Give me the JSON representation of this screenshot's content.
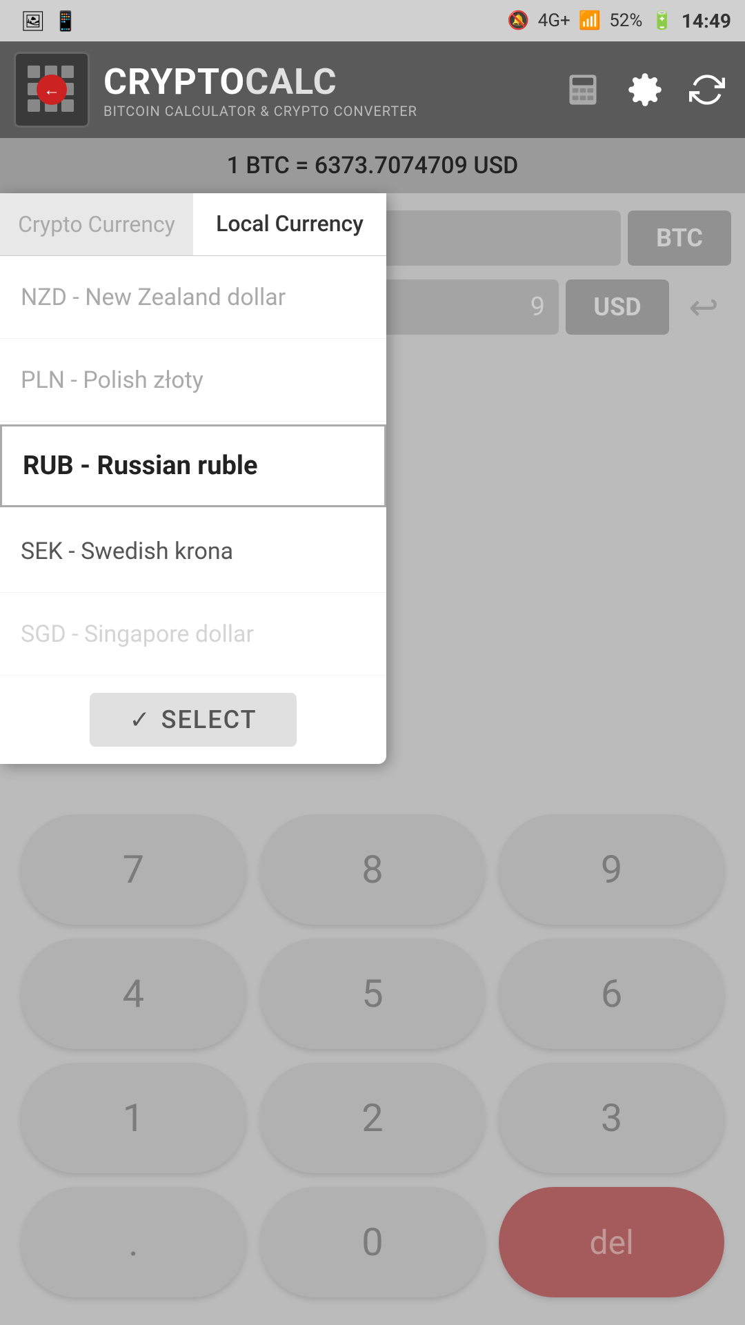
{
  "statusBar": {
    "leftIcons": [
      "image-icon",
      "phone-icon"
    ],
    "rightIcons": "🔕 4G+ .il 52% 🔋 14:49",
    "signal": "4G+",
    "battery": "52%",
    "time": "14:49"
  },
  "header": {
    "appName": "CRYPTOCALC",
    "cryptoPart": "CRYPTO",
    "calcPart": "CALC",
    "subtitle": "BITCOIN CALCULATOR & CRYPTO CONVERTER",
    "icons": {
      "calculator": "calculator-icon",
      "settings": "settings-icon",
      "refresh": "refresh-icon"
    }
  },
  "rateBar": {
    "text": "1 BTC = 6373.7074709 USD"
  },
  "currencyRows": [
    {
      "value": "",
      "currency": "BTC"
    },
    {
      "value": "9",
      "currency": "USD"
    }
  ],
  "modal": {
    "tabs": [
      {
        "label": "Crypto Currency",
        "active": false
      },
      {
        "label": "Local Currency",
        "active": true
      }
    ],
    "listItems": [
      {
        "code": "NZD",
        "name": "New Zealand dollar",
        "selected": false,
        "fade": true
      },
      {
        "code": "PLN",
        "name": "Polish złoty",
        "selected": false,
        "fade": true
      },
      {
        "code": "RUB",
        "name": "Russian ruble",
        "selected": true,
        "fade": false
      },
      {
        "code": "SEK",
        "name": "Swedish krona",
        "selected": false,
        "fade": false
      },
      {
        "code": "SGD",
        "name": "Singapore dollar",
        "selected": false,
        "fade": true,
        "partial": true
      }
    ],
    "selectButton": {
      "label": "SELECT",
      "icon": "✓"
    }
  },
  "keypad": {
    "keys": [
      {
        "label": "7",
        "type": "number"
      },
      {
        "label": "8",
        "type": "number"
      },
      {
        "label": "9",
        "type": "number"
      },
      {
        "label": "4",
        "type": "number"
      },
      {
        "label": "5",
        "type": "number"
      },
      {
        "label": "6",
        "type": "number"
      },
      {
        "label": "1",
        "type": "number"
      },
      {
        "label": "2",
        "type": "number"
      },
      {
        "label": "3",
        "type": "number"
      },
      {
        "label": ".",
        "type": "decimal"
      },
      {
        "label": "0",
        "type": "number"
      },
      {
        "label": "del",
        "type": "delete"
      }
    ]
  }
}
